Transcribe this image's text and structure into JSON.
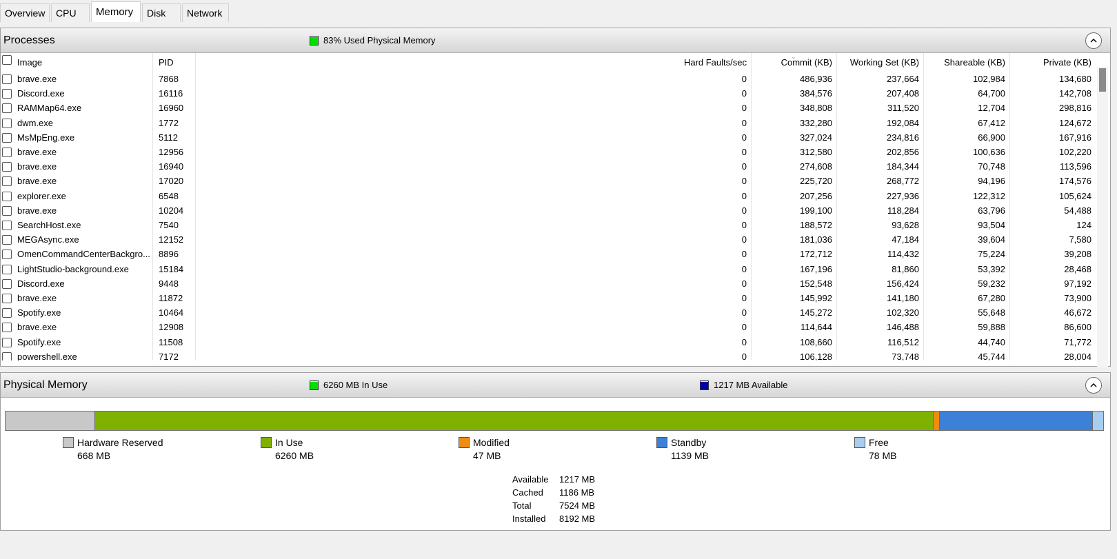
{
  "tabs": [
    {
      "label": "Overview",
      "active": false
    },
    {
      "label": "CPU",
      "active": false
    },
    {
      "label": "Memory",
      "active": true
    },
    {
      "label": "Disk",
      "active": false
    },
    {
      "label": "Network",
      "active": false
    }
  ],
  "processes": {
    "title": "Processes",
    "status_text": "83% Used Physical Memory",
    "status_color": "#00e000",
    "columns": {
      "image": "Image",
      "pid": "PID",
      "hard_faults": "Hard Faults/sec",
      "commit": "Commit (KB)",
      "working_set": "Working Set (KB)",
      "shareable": "Shareable (KB)",
      "private": "Private (KB)"
    },
    "rows": [
      {
        "image": "brave.exe",
        "pid": "7868",
        "hard_faults": "0",
        "commit": "486,936",
        "working_set": "237,664",
        "shareable": "102,984",
        "private": "134,680"
      },
      {
        "image": "Discord.exe",
        "pid": "16116",
        "hard_faults": "0",
        "commit": "384,576",
        "working_set": "207,408",
        "shareable": "64,700",
        "private": "142,708"
      },
      {
        "image": "RAMMap64.exe",
        "pid": "16960",
        "hard_faults": "0",
        "commit": "348,808",
        "working_set": "311,520",
        "shareable": "12,704",
        "private": "298,816"
      },
      {
        "image": "dwm.exe",
        "pid": "1772",
        "hard_faults": "0",
        "commit": "332,280",
        "working_set": "192,084",
        "shareable": "67,412",
        "private": "124,672"
      },
      {
        "image": "MsMpEng.exe",
        "pid": "5112",
        "hard_faults": "0",
        "commit": "327,024",
        "working_set": "234,816",
        "shareable": "66,900",
        "private": "167,916"
      },
      {
        "image": "brave.exe",
        "pid": "12956",
        "hard_faults": "0",
        "commit": "312,580",
        "working_set": "202,856",
        "shareable": "100,636",
        "private": "102,220"
      },
      {
        "image": "brave.exe",
        "pid": "16940",
        "hard_faults": "0",
        "commit": "274,608",
        "working_set": "184,344",
        "shareable": "70,748",
        "private": "113,596"
      },
      {
        "image": "brave.exe",
        "pid": "17020",
        "hard_faults": "0",
        "commit": "225,720",
        "working_set": "268,772",
        "shareable": "94,196",
        "private": "174,576"
      },
      {
        "image": "explorer.exe",
        "pid": "6548",
        "hard_faults": "0",
        "commit": "207,256",
        "working_set": "227,936",
        "shareable": "122,312",
        "private": "105,624"
      },
      {
        "image": "brave.exe",
        "pid": "10204",
        "hard_faults": "0",
        "commit": "199,100",
        "working_set": "118,284",
        "shareable": "63,796",
        "private": "54,488"
      },
      {
        "image": "SearchHost.exe",
        "pid": "7540",
        "hard_faults": "0",
        "commit": "188,572",
        "working_set": "93,628",
        "shareable": "93,504",
        "private": "124"
      },
      {
        "image": "MEGAsync.exe",
        "pid": "12152",
        "hard_faults": "0",
        "commit": "181,036",
        "working_set": "47,184",
        "shareable": "39,604",
        "private": "7,580"
      },
      {
        "image": "OmenCommandCenterBackgro...",
        "pid": "8896",
        "hard_faults": "0",
        "commit": "172,712",
        "working_set": "114,432",
        "shareable": "75,224",
        "private": "39,208"
      },
      {
        "image": "LightStudio-background.exe",
        "pid": "15184",
        "hard_faults": "0",
        "commit": "167,196",
        "working_set": "81,860",
        "shareable": "53,392",
        "private": "28,468"
      },
      {
        "image": "Discord.exe",
        "pid": "9448",
        "hard_faults": "0",
        "commit": "152,548",
        "working_set": "156,424",
        "shareable": "59,232",
        "private": "97,192"
      },
      {
        "image": "brave.exe",
        "pid": "11872",
        "hard_faults": "0",
        "commit": "145,992",
        "working_set": "141,180",
        "shareable": "67,280",
        "private": "73,900"
      },
      {
        "image": "Spotify.exe",
        "pid": "10464",
        "hard_faults": "0",
        "commit": "145,272",
        "working_set": "102,320",
        "shareable": "55,648",
        "private": "46,672"
      },
      {
        "image": "brave.exe",
        "pid": "12908",
        "hard_faults": "0",
        "commit": "114,644",
        "working_set": "146,488",
        "shareable": "59,888",
        "private": "86,600"
      },
      {
        "image": "Spotify.exe",
        "pid": "11508",
        "hard_faults": "0",
        "commit": "108,660",
        "working_set": "116,512",
        "shareable": "44,740",
        "private": "71,772"
      },
      {
        "image": "powershell.exe",
        "pid": "7172",
        "hard_faults": "0",
        "commit": "106,128",
        "working_set": "73,748",
        "shareable": "45,744",
        "private": "28,004"
      }
    ]
  },
  "physical_memory": {
    "title": "Physical Memory",
    "in_use_text": "6260 MB In Use",
    "in_use_color": "#00e000",
    "available_text": "1217 MB Available",
    "available_color": "#0000b0",
    "bar_segments": [
      {
        "name": "Hardware Reserved",
        "mb": 668,
        "color": "#c8c8c8"
      },
      {
        "name": "In Use",
        "mb": 6260,
        "color": "#80b000"
      },
      {
        "name": "Modified",
        "mb": 47,
        "color": "#f08c10"
      },
      {
        "name": "Standby",
        "mb": 1139,
        "color": "#3c80d8"
      },
      {
        "name": "Free",
        "mb": 78,
        "color": "#a8cdf0"
      }
    ],
    "legend": [
      {
        "label": "Hardware Reserved",
        "value": "668 MB",
        "color": "#c8c8c8"
      },
      {
        "label": "In Use",
        "value": "6260 MB",
        "color": "#80b000"
      },
      {
        "label": "Modified",
        "value": "47 MB",
        "color": "#f08c10"
      },
      {
        "label": "Standby",
        "value": "1139 MB",
        "color": "#3c80d8"
      },
      {
        "label": "Free",
        "value": "78 MB",
        "color": "#a8cdf0"
      }
    ],
    "stats": [
      {
        "label": "Available",
        "value": "1217 MB"
      },
      {
        "label": "Cached",
        "value": "1186 MB"
      },
      {
        "label": "Total",
        "value": "7524 MB"
      },
      {
        "label": "Installed",
        "value": "8192 MB"
      }
    ]
  }
}
